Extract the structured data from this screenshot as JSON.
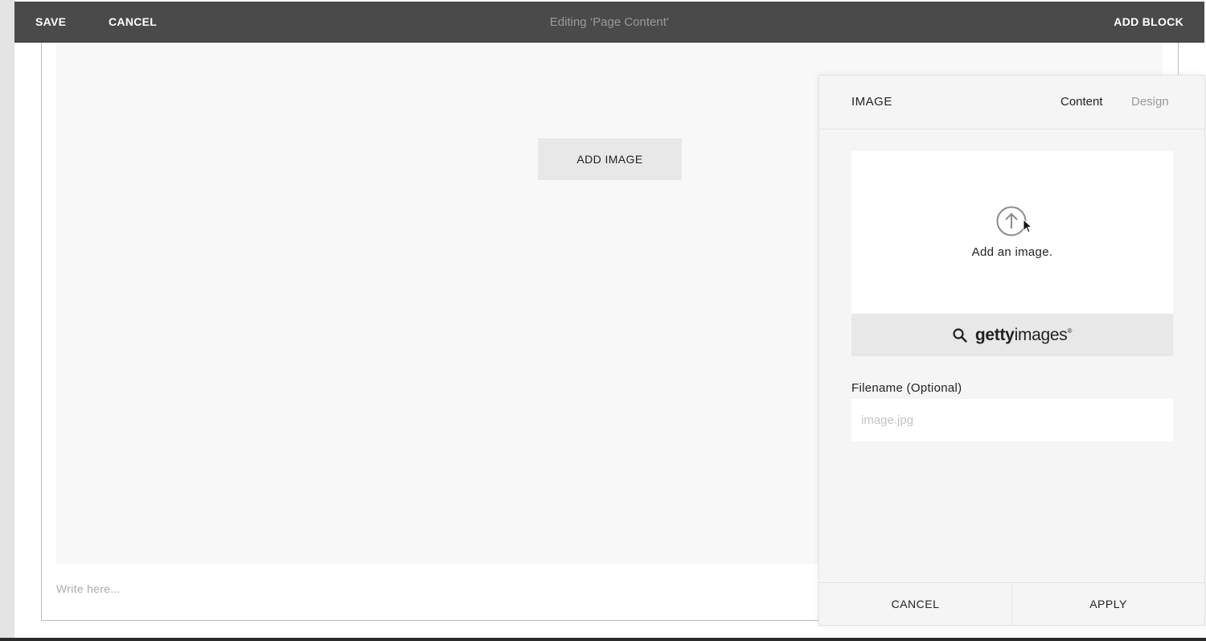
{
  "topbar": {
    "save_label": "SAVE",
    "cancel_label": "CANCEL",
    "title": "Editing ‘Page Content’",
    "add_block_label": "ADD BLOCK"
  },
  "content": {
    "add_image_label": "ADD IMAGE",
    "write_placeholder": "Write here..."
  },
  "panel": {
    "title": "IMAGE",
    "tabs": [
      {
        "label": "Content",
        "active": true
      },
      {
        "label": "Design",
        "active": false
      }
    ],
    "upload_text": "Add an image.",
    "getty": {
      "bold": "getty",
      "light": "images",
      "mark": "®"
    },
    "filename_label": "Filename (Optional)",
    "filename_placeholder": "image.jpg",
    "filename_value": "",
    "cancel_label": "CANCEL",
    "apply_label": "APPLY"
  },
  "icons": {
    "upload": "upload-arrow-circle-icon",
    "search": "search-icon",
    "cursor": "mouse-pointer-icon"
  }
}
